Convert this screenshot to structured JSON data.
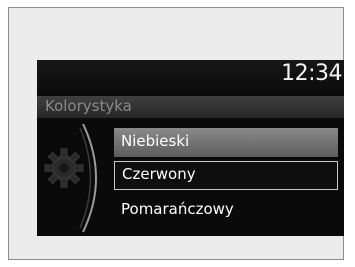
{
  "header": {
    "time": "12:34"
  },
  "menu": {
    "title": "Kolorystyka",
    "icon": "gear-icon",
    "items": [
      {
        "label": "Niebieski",
        "state": "highlighted"
      },
      {
        "label": "Czerwony",
        "state": "selected"
      },
      {
        "label": "Pomarańczowy",
        "state": "normal"
      }
    ]
  },
  "colors": {
    "screen_background": "#0a0a0a",
    "highlight": "#7a7a7a",
    "selection_border": "#c8c8c8",
    "title_text": "#8a8a8a"
  }
}
